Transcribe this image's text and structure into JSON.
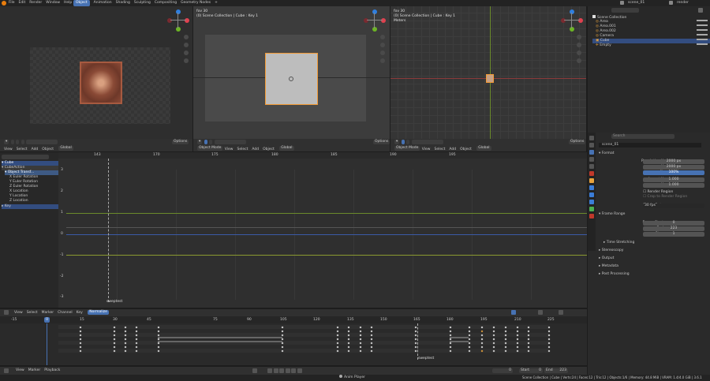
{
  "topbar": {
    "menus": [
      "File",
      "Edit",
      "Render",
      "Window",
      "Help"
    ],
    "tabs": [
      "Object",
      "Animation",
      "Shading",
      "Sculpting",
      "Compositing",
      "Geometry Nodes"
    ],
    "active_tab": "Object",
    "add_tab": "+",
    "scene": "scene_01",
    "view_layer": "render"
  },
  "vp2": {
    "title": "fov 30",
    "subtitle": "(0) Scene Collection | Cube : Key 1"
  },
  "vp3": {
    "title": "fov 30",
    "subtitle": "(0) Scene Collection | Cube : Key 1",
    "units": "Meters"
  },
  "viewport_menus": {
    "view": "View",
    "select": "Select",
    "add": "Add",
    "object": "Object",
    "mode": "Object Mode",
    "global": "Global",
    "options": "Options"
  },
  "outliner": {
    "title": "Scene Collection",
    "items": [
      "Area",
      "Area.001",
      "Area.002",
      "Camera",
      "Cube",
      "Empty"
    ]
  },
  "graph": {
    "channels": [
      "Cube",
      "CubeAction",
      "Object Transf...",
      "X Euler Rotation",
      "Y Euler Rotation",
      "Z Euler Rotation",
      "X Location",
      "Y Location",
      "Z Location",
      "Key"
    ],
    "ruler": [
      "143",
      "170",
      "175",
      "180",
      "185",
      "190",
      "195"
    ],
    "yticks": [
      "3",
      "2",
      "1",
      "0",
      "-1",
      "-2",
      "-3"
    ],
    "marker": "sweptest",
    "menus": [
      "View",
      "Select",
      "Marker",
      "Channel",
      "Key"
    ]
  },
  "dopesheet": {
    "menus": [
      "View",
      "Select",
      "Marker",
      "Channel",
      "Key"
    ],
    "mode": "Normalize",
    "ruler": [
      "-15",
      "15",
      "30",
      "45",
      "75",
      "90",
      "105",
      "120",
      "135",
      "150",
      "165",
      "180",
      "195",
      "210",
      "225"
    ],
    "current_frame": "0",
    "marker": "sweptest"
  },
  "timeline": {
    "menus": [
      "View",
      "Marker",
      "Playback"
    ],
    "frame": "0",
    "start_label": "Start",
    "start": "0",
    "end_label": "End",
    "end": "223"
  },
  "properties": {
    "search_placeholder": "Search",
    "scene_name": "scene_01",
    "format": "Format",
    "res_x_label": "Resolution X",
    "res_x": "2000 px",
    "res_y_label": "Y",
    "res_y": "2000 px",
    "pct_label": "%",
    "pct": "100%",
    "aspect_label": "Aspect X",
    "aspect_x": "1.000",
    "aspect_y_label": "Y",
    "aspect_y": "1.000",
    "render_region": "Render Region",
    "crop": "Crop to Render Region",
    "fps_label": "Frame Rate",
    "fps": "30 fps",
    "frame_range": "Frame Range",
    "start_label": "Frame Start",
    "start": "0",
    "end_label": "End",
    "end": "223",
    "step_label": "Step",
    "step": "1",
    "time_stretching": "Time Stretching",
    "stereoscopy": "Stereoscopy",
    "output": "Output",
    "metadata": "Metadata",
    "post_processing": "Post Processing"
  },
  "status": {
    "anim_player": "Anim Player",
    "info": "Scene Collection | Cube | Verts:24 | Faces:12 | Tris:12 | Objects:1/6 | Memory: 44.8 MiB | VRAM: 1.4/4.0 GiB | 3.6.1"
  }
}
